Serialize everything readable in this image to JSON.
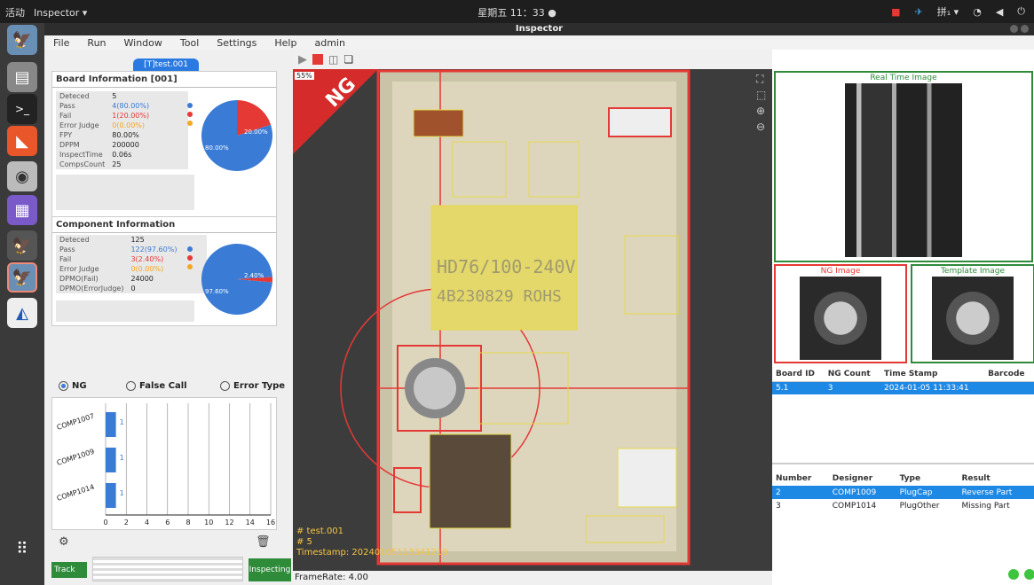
{
  "topbar": {
    "activities": "活动",
    "app": "Inspector ▾",
    "clock": "星期五 11：33 ●",
    "ime": "拼₁ ▾"
  },
  "window": {
    "title": "Inspector"
  },
  "menu": [
    "File",
    "Run",
    "Window",
    "Tool",
    "Settings",
    "Help",
    "admin"
  ],
  "left": {
    "tab": "[T]test.001",
    "board": {
      "title": "Board Information [001]",
      "rows": [
        [
          "Deteced",
          "5"
        ],
        [
          "Pass",
          "4(80.00%)"
        ],
        [
          "Fail",
          "1(20.00%)"
        ],
        [
          "Error Judge",
          "0(0.00%)"
        ],
        [
          "FPY",
          "80.00%"
        ],
        [
          "DPPM",
          "200000"
        ],
        [
          "InspectTime",
          "0.06s"
        ],
        [
          "CompsCount",
          "25"
        ]
      ],
      "pie": {
        "pass_pct": 80,
        "fail_pct": 20,
        "pass_label": "80.00%",
        "fail_label": "20.00%"
      }
    },
    "component": {
      "title": "Component Information",
      "rows": [
        [
          "Deteced",
          "125"
        ],
        [
          "Pass",
          "122(97.60%)"
        ],
        [
          "Fail",
          "3(2.40%)"
        ],
        [
          "Error Judge",
          "0(0.00%)"
        ],
        [
          "DPMO(Fail)",
          "24000"
        ],
        [
          "DPMO(ErrorJudge)",
          "0"
        ]
      ],
      "pie": {
        "pass_pct": 97.6,
        "fail_pct": 2.4,
        "pass_label": "97.60%",
        "fail_label": "2.40%"
      }
    },
    "radios": [
      {
        "label": "NG",
        "on": true
      },
      {
        "label": "False Call",
        "on": false
      },
      {
        "label": "Error Type",
        "on": false
      }
    ],
    "bars": {
      "items": [
        {
          "name": "COMP1007",
          "value": 1
        },
        {
          "name": "COMP1009",
          "value": 1
        },
        {
          "name": "COMP1014",
          "value": 1
        }
      ],
      "ticks": [
        "0",
        "2",
        "4",
        "6",
        "8",
        "10",
        "12",
        "14",
        "16"
      ],
      "xmax": 16
    },
    "track": "Track",
    "inspecting": "Inspecting"
  },
  "center": {
    "zoom": "55%",
    "ng": "NG",
    "overlay": [
      "# test.001",
      "# 5",
      "Timestamp: 20240105113341219"
    ],
    "framerate": "FrameRate: 4.00",
    "pcb_text": [
      "HD76/100-240V",
      "4B230829 ROHS"
    ]
  },
  "right": {
    "realtime": "Real Time Image",
    "ng_image": "NG Image",
    "template": "Template Image",
    "board_table": {
      "headers": [
        "Board ID",
        "NG Count",
        "Time Stamp",
        "Barcode"
      ],
      "rows": [
        [
          "5.1",
          "3",
          "2024-01-05 11:33:41",
          ""
        ]
      ]
    },
    "comp_table": {
      "headers": [
        "Number",
        "Designer",
        "Type",
        "Result"
      ],
      "rows": [
        [
          "2",
          "COMP1009",
          "PlugCap",
          "Reverse Part"
        ],
        [
          "3",
          "COMP1014",
          "PlugOther",
          "Missing Part"
        ]
      ]
    }
  },
  "colors": {
    "pass": "#3a7bd5",
    "fail": "#e53935",
    "judge": "#f5a623",
    "green": "#2e8b3a",
    "ng_red": "#e53935"
  }
}
